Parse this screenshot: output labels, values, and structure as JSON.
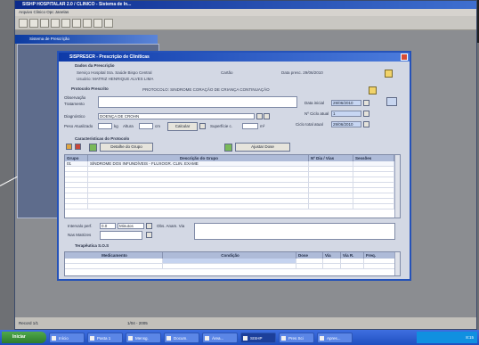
{
  "app": {
    "title": "SISHP HOSPITALAR 2.0 / CLINICO - Sistema de In...",
    "menu": "Arquivo  Clinico   Opc   Janelas",
    "subwindow_title": "Sistema de Prescrição"
  },
  "dialog": {
    "title": "SISPRESCR - Prescrição de Cliníticas",
    "section_data": "Dados da Prescrição",
    "hospital_line": "Serviço Hospital Sra. Saúde Bispo Central",
    "patient_line": "Usuário: MATRIZ HENRIQUE ALVES LIMA",
    "card_label": "Cartão",
    "date_label": "Data presc. 29/06/2010",
    "section_prescription": "Protocolo Prescrito",
    "protocol_text": "PROTOCOLO: SINDROME CORAÇÃO DE CRIANÇA CONTINUAÇÃO",
    "obs_label": "Observação",
    "treatment_label": "Tratamento",
    "diagnosis_label": "Diagnóstico",
    "diagnosis_value": "DOENÇA DE CROHN",
    "weight_label": "Peso Atualizado",
    "weight_unit": "kg",
    "height_label": "Altura",
    "height_unit": "cm",
    "calc_button": "Calcular",
    "surface_label": "Superfície c.",
    "surface_unit": "m²",
    "start_date_label": "Data inicial",
    "start_date_value": "29/06/2010",
    "cycle_label": "Nº Ciclo atual",
    "cycle_value": "1",
    "total_cycles_label": "Ciclo total atual",
    "total_cycles_value": "29/06/2010",
    "section_protocol": "Características do Protocolo",
    "sessions_button": "Detalhe do Grupo",
    "add_button": "Ajustar Dose",
    "grid_headers": [
      "Grupo",
      "Descrição do Grupo",
      "Nº Dia / Vias",
      "Sessões"
    ],
    "grid_rows": [
      [
        "01",
        "SÍNDROME DOS INFUNDÍVEIS - FLUXOGR. CLIN. EXAME",
        "",
        ""
      ]
    ],
    "interval_label": "Intervalo perf.",
    "interval_value": "0.0",
    "interval_unit": "Minutos",
    "obs_field_label": "Obs. Anam. Via",
    "notes_label": "Nas Matrizes",
    "section_therapy": "Terapêutica S.O.S",
    "therapy_headers": [
      "Medicamento",
      "Condição",
      "Dose",
      "Via",
      "Via R.",
      "Freq."
    ]
  },
  "statusbar": {
    "left": "Record 1/1",
    "middle": "1/04 - 2005"
  },
  "taskbar": {
    "start": "Iniciar",
    "buttons": [
      "Início",
      "Pasta 1",
      "Mensg.",
      "Docum.",
      "Área...",
      "SISHP",
      "Pres Sci",
      "Apres..."
    ],
    "active_index": 5,
    "tray": "8:15"
  }
}
